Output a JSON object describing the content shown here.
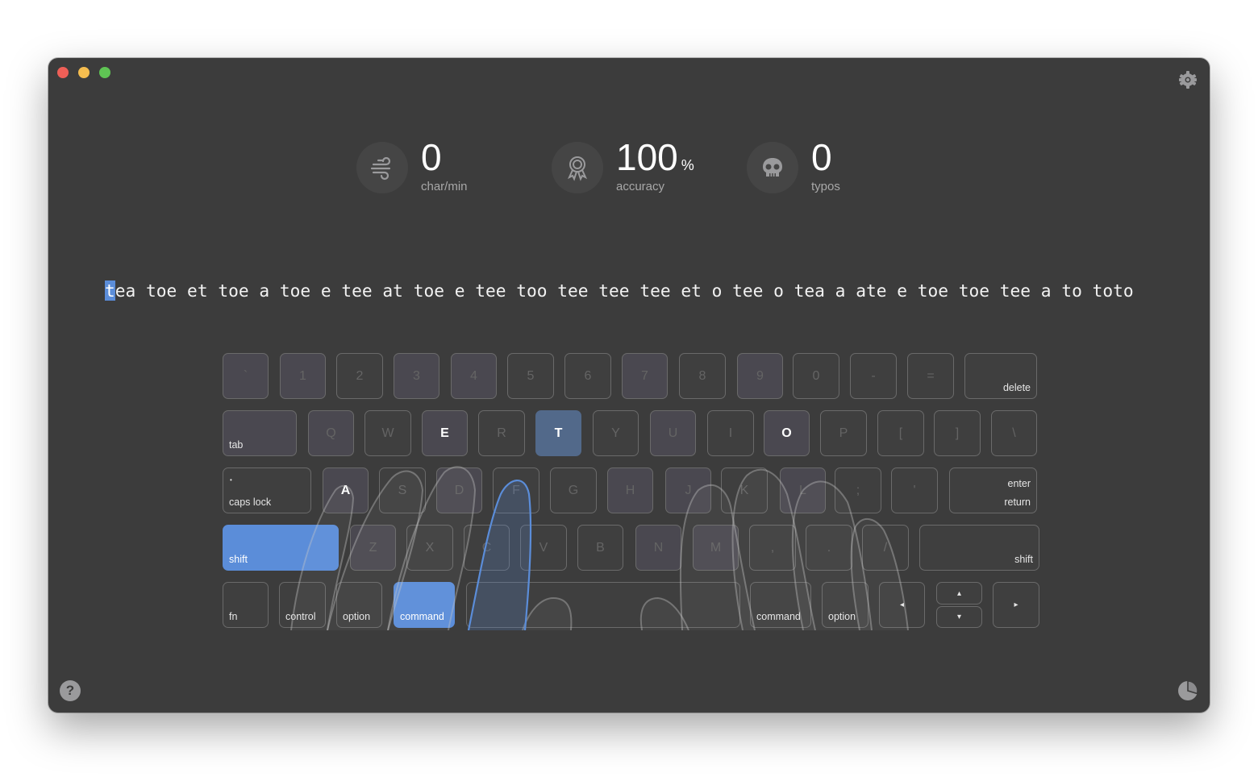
{
  "window": {
    "traffic_lights": [
      "close",
      "minimize",
      "maximize"
    ],
    "settings_icon": "gear-icon",
    "help_icon": "question-icon",
    "stats_icon": "pie-chart-icon"
  },
  "stats": {
    "speed": {
      "icon": "wind-icon",
      "value": "0",
      "label": "char/min"
    },
    "accuracy": {
      "icon": "award-ribbon-icon",
      "value": "100",
      "unit": "%",
      "label": "accuracy"
    },
    "typos": {
      "icon": "skull-icon",
      "value": "0",
      "label": "typos"
    }
  },
  "practice": {
    "current_char": "t",
    "remaining_text": "ea toe et toe a toe e tee at toe e tee too tee tee tee et o tee o tea a ate e toe toe tee a to toto"
  },
  "keyboard": {
    "row1": [
      "`",
      "1",
      "2",
      "3",
      "4",
      "5",
      "6",
      "7",
      "8",
      "9",
      "0",
      "-",
      "="
    ],
    "delete": "delete",
    "tab": "tab",
    "row2": [
      "Q",
      "W",
      "E",
      "R",
      "T",
      "Y",
      "U",
      "I",
      "O",
      "P",
      "[",
      "]",
      "\\"
    ],
    "caps_lock": "caps lock",
    "caps_dot": "•",
    "row3": [
      "A",
      "S",
      "D",
      "F",
      "G",
      "H",
      "J",
      "K",
      "L",
      ";",
      "'"
    ],
    "enter": "enter",
    "return": "return",
    "shift_left": "shift",
    "row4": [
      "Z",
      "X",
      "C",
      "V",
      "B",
      "N",
      "M",
      ",",
      ".",
      "/"
    ],
    "shift_right": "shift",
    "fn": "fn",
    "control": "control",
    "option_left": "option",
    "command_left": "command",
    "command_right": "command",
    "option_right": "option",
    "arrow_left": "◂",
    "arrow_up": "▴",
    "arrow_down": "▾",
    "arrow_right": "▸",
    "highlighted_next_key": "T",
    "active_modifiers": [
      "shift_left",
      "command_left"
    ],
    "practice_keys": [
      "A",
      "E",
      "O",
      "T"
    ],
    "colors": {
      "next_key": "#52698a",
      "active_modifier": "#5b8dd9",
      "finger_highlight": "#5b8dd9"
    }
  }
}
